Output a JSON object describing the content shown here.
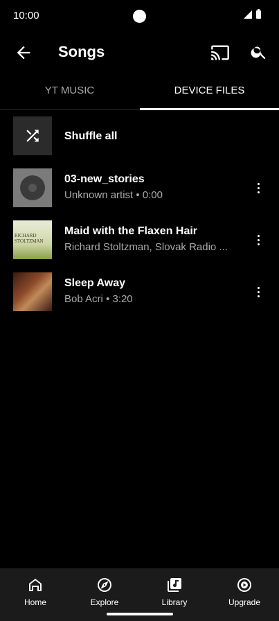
{
  "status": {
    "time": "10:00"
  },
  "header": {
    "title": "Songs"
  },
  "tabs": [
    {
      "label": "YT MUSIC",
      "selected": false
    },
    {
      "label": "DEVICE FILES",
      "selected": true
    }
  ],
  "list": {
    "shuffle_label": "Shuffle all",
    "songs": [
      {
        "title": "03-new_stories",
        "subtitle": "Unknown artist • 0:00"
      },
      {
        "title": "Maid with the Flaxen Hair",
        "subtitle": "Richard Stoltzman, Slovak Radio ...",
        "art_text_1": "RICHARD",
        "art_text_2": "STOLTZMAN"
      },
      {
        "title": "Sleep Away",
        "subtitle": "Bob Acri • 3:20"
      }
    ]
  },
  "bottom_nav": [
    {
      "label": "Home",
      "icon": "home-icon"
    },
    {
      "label": "Explore",
      "icon": "compass-icon"
    },
    {
      "label": "Library",
      "icon": "library-icon"
    },
    {
      "label": "Upgrade",
      "icon": "upgrade-icon"
    }
  ],
  "colors": {
    "background": "#000000",
    "nav_background": "#1b1b1b",
    "muted_text": "#aaaaaa"
  }
}
